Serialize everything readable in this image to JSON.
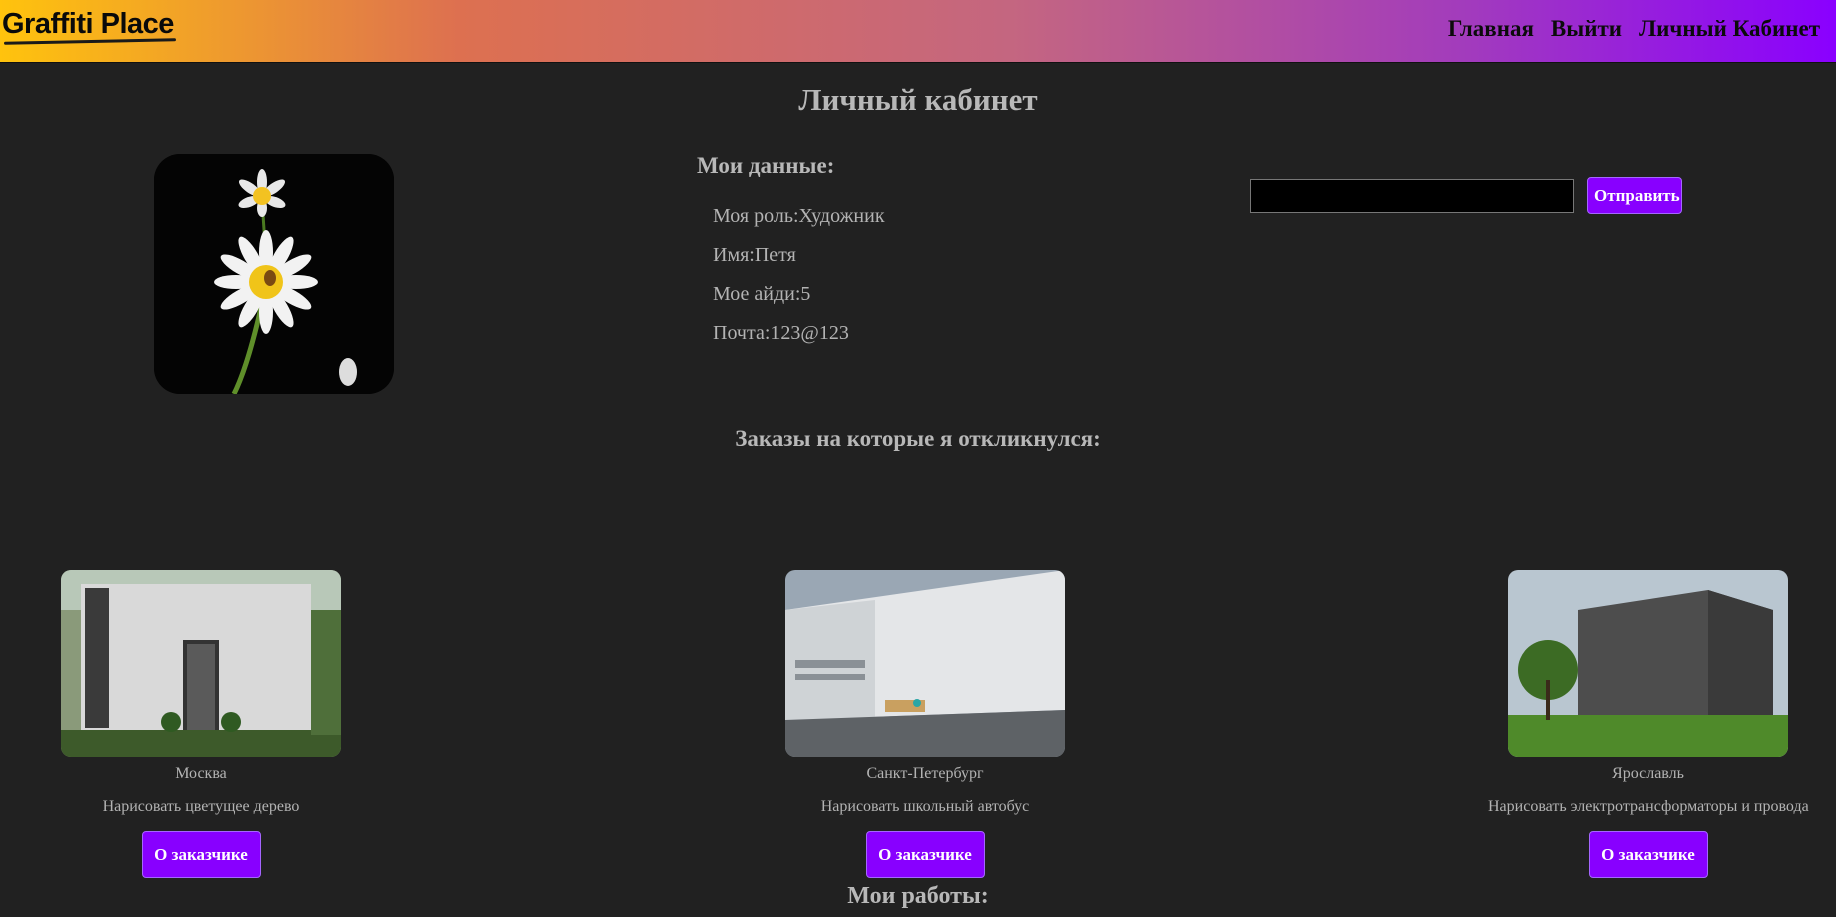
{
  "header": {
    "logo": "Graffiti Place",
    "nav": [
      "Главная",
      "Выйти",
      "Личный Кабинет"
    ]
  },
  "profile": {
    "title": "Личный кабинет",
    "my_data_heading": "Мои данные:",
    "role": "Моя роль:Художник",
    "name": "Имя:Петя",
    "id": "Мое айди:5",
    "email": "Почта:123@123",
    "send_label": "Отправить",
    "upload_value": ""
  },
  "orders": {
    "heading": "Заказы на которые я откликнулся:",
    "items": [
      {
        "city": "Москва",
        "task": "Нарисовать цветущее дерево",
        "button": "О заказчике"
      },
      {
        "city": "Санкт-Петербург",
        "task": "Нарисовать школьный автобус",
        "button": "О заказчике"
      },
      {
        "city": "Ярославль",
        "task": "Нарисовать электротрансформаторы и провода",
        "button": "О заказчике"
      }
    ]
  },
  "works": {
    "heading": "Мои работы:"
  },
  "colors": {
    "accent": "#8800ff",
    "background": "#212121"
  }
}
